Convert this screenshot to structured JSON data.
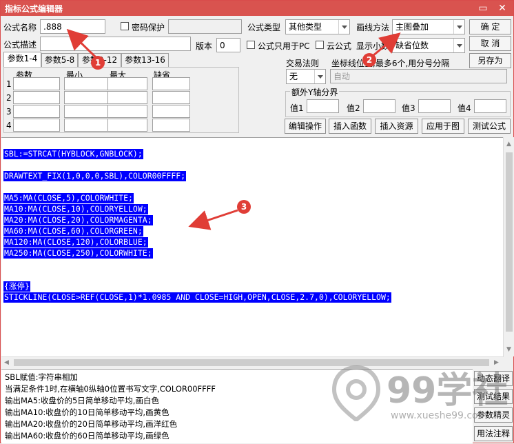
{
  "window": {
    "title": "指标公式编辑器",
    "minimize_glyph": "▭",
    "close_glyph": "✕"
  },
  "formula": {
    "name_label": "公式名称",
    "name_value": ".888",
    "password_label": "密码保护",
    "desc_label": "公式描述",
    "version_label": "版本",
    "version_value": "0",
    "pc_only_label": "公式只用于PC",
    "cloud_label": "云公式",
    "show_decimal_label": "显示小数",
    "type_label": "公式类型",
    "type_value": "其他类型",
    "draw_label": "画线方法",
    "draw_value": "主图叠加",
    "decimal_value": "缺省位数"
  },
  "actions": {
    "ok": "确  定",
    "cancel": "取  消",
    "save_as": "另存为"
  },
  "tabs": [
    "参数1-4",
    "参数5-8",
    "参数9-12",
    "参数13-16"
  ],
  "params": {
    "headers": [
      "参数",
      "最小",
      "最大",
      "缺省"
    ],
    "rows": [
      "1",
      "2",
      "3",
      "4"
    ]
  },
  "trade": {
    "rule_label": "交易法则",
    "rule_value": "无",
    "coord_label": "坐标线位置,最多6个,用分号分隔",
    "coord_value": "自动"
  },
  "yaxis": {
    "title": "额外Y轴分界",
    "labels": [
      "值1",
      "值2",
      "值3",
      "值4"
    ]
  },
  "tools": {
    "edit": "编辑操作",
    "insert_func": "插入函数",
    "insert_res": "插入资源",
    "apply": "应用于图",
    "test": "测试公式"
  },
  "code_lines": [
    "SBL:=STRCAT(HYBLOCK,GNBLOCK);",
    "DRAWTEXT_FIX(1,0,0,0,SBL),COLOR00FFFF;",
    "MA5:MA(CLOSE,5),COLORWHITE;",
    "MA10:MA(CLOSE,10),COLORYELLOW;",
    "MA20:MA(CLOSE,20),COLORMAGENTA;",
    "MA60:MA(CLOSE,60),COLORGREEN;",
    "MA120:MA(CLOSE,120),COLORBLUE;",
    "MA250:MA(CLOSE,250),COLORWHITE;",
    "{涨停}",
    "STICKLINE(CLOSE>REF(CLOSE,1)*1.0985 AND CLOSE=HIGH,OPEN,CLOSE,2.7,0),COLORYELLOW;"
  ],
  "help_lines": [
    "SBL赋值:字符串相加",
    "当满足条件1时,在横轴0纵轴0位置书写文字,COLOR00FFFF",
    "输出MA5:收盘价的5日简单移动平均,画白色",
    "输出MA10:收盘价的10日简单移动平均,画黄色",
    "输出MA20:收盘价的20日简单移动平均,画洋红色",
    "输出MA60:收盘价的60日简单移动平均,画绿色"
  ],
  "side_buttons": [
    "动态翻译",
    "测试结果",
    "参数精灵",
    "用法注释"
  ],
  "annotations": [
    "1",
    "2",
    "3"
  ],
  "watermark": {
    "brand": "99学社",
    "url": "www.xueshe99.com"
  },
  "colors": {
    "title_bar": "#d9534f",
    "code_highlight": "#0000ff",
    "annotation": "#e03d36"
  }
}
